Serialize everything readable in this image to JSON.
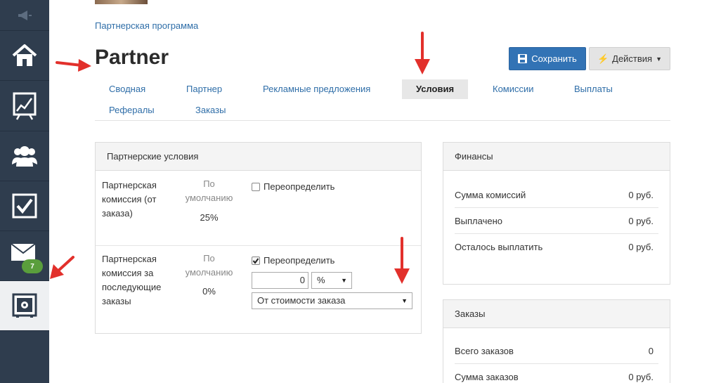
{
  "sidebar": {
    "items": [
      {
        "icon": "home-icon"
      },
      {
        "icon": "chart-icon"
      },
      {
        "icon": "users-icon"
      },
      {
        "icon": "checkbox-icon"
      },
      {
        "icon": "mail-icon",
        "badge": "7"
      },
      {
        "icon": "safe-icon",
        "active": true
      }
    ]
  },
  "header": {
    "breadcrumb": "Партнерская программа",
    "title": "Partner",
    "save_label": "Сохранить",
    "actions_label": "Действия"
  },
  "tabs": [
    {
      "label": "Сводная"
    },
    {
      "label": "Партнер"
    },
    {
      "label": "Рекламные предложения"
    },
    {
      "label": "Условия",
      "active": true
    },
    {
      "label": "Комиссии"
    },
    {
      "label": "Выплаты"
    },
    {
      "label": "Рефералы"
    },
    {
      "label": "Заказы"
    }
  ],
  "conditions": {
    "title": "Партнерские условия",
    "rows": [
      {
        "label_lines": [
          "Партнерская",
          "комиссия (от",
          "заказа)"
        ],
        "default_lines": [
          "По",
          "умолчанию"
        ],
        "default_value": "25%",
        "override_label": "Переопределить",
        "override_checked": false
      },
      {
        "label_lines": [
          "Партнерская",
          "комиссия за",
          "последующие",
          "заказы"
        ],
        "default_lines": [
          "По",
          "умолчанию"
        ],
        "default_value": "0%",
        "override_label": "Переопределить",
        "override_checked": true,
        "amount_value": "0",
        "unit_value": "%",
        "base_value": "От стоимости заказа"
      }
    ]
  },
  "finance": {
    "title": "Финансы",
    "rows": [
      {
        "label": "Сумма комиссий",
        "value": "0 руб."
      },
      {
        "label": "Выплачено",
        "value": "0 руб."
      },
      {
        "label": "Осталось выплатить",
        "value": "0 руб."
      }
    ]
  },
  "orders": {
    "title": "Заказы",
    "rows": [
      {
        "label": "Всего заказов",
        "value": "0"
      },
      {
        "label": "Сумма заказов",
        "value": "0 руб."
      }
    ]
  },
  "colors": {
    "sidebar": "#2f3d4e",
    "accent": "#3273b5",
    "link": "#2f6ea8",
    "annotation": "#e2302b",
    "badge": "#5a9e3c"
  }
}
